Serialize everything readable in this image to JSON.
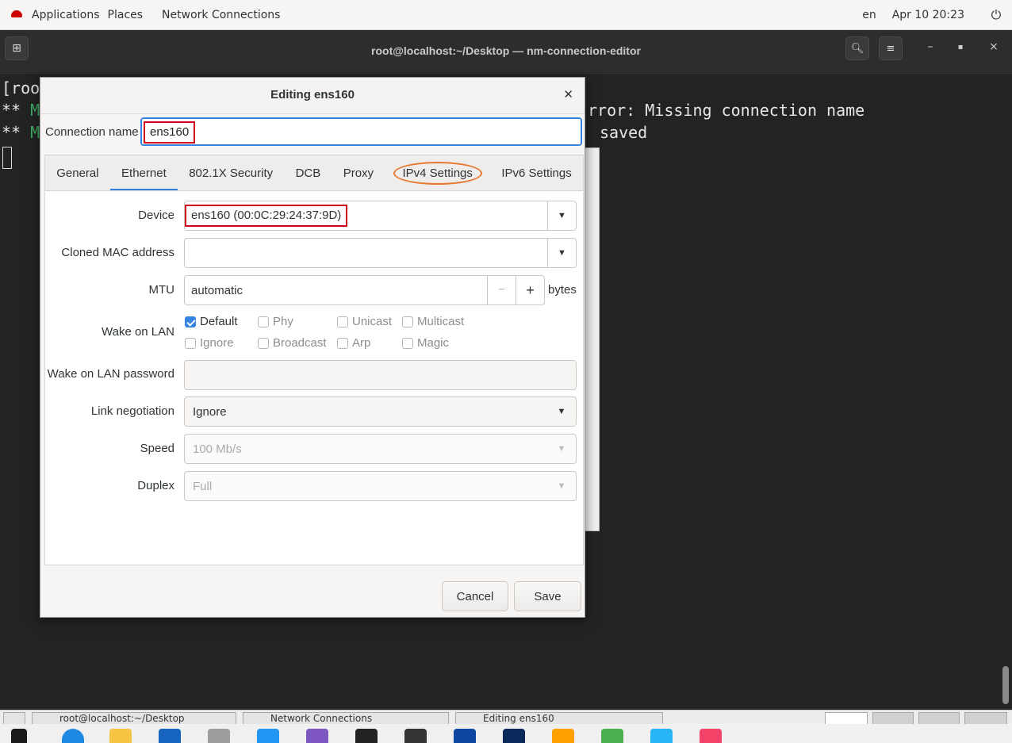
{
  "topbar": {
    "applications": "Applications",
    "places": "Places",
    "network_connections": "Network Connections",
    "lang": "en",
    "datetime": "Apr 10  20:23"
  },
  "terminal": {
    "title": "root@localhost:~/Desktop — nm-connection-editor",
    "lines": [
      "[roo",
      "** M",
      "** M"
    ],
    "right_line1": "rror: Missing connection name",
    "right_line2": "saved"
  },
  "dialog": {
    "title": "Editing ens160",
    "connection_name_label": "Connection name",
    "connection_name_value": "ens160",
    "tabs": [
      "General",
      "Ethernet",
      "802.1X Security",
      "DCB",
      "Proxy",
      "IPv4 Settings",
      "IPv6 Settings"
    ],
    "active_tab": "Ethernet",
    "device_label": "Device",
    "device_value": "ens160 (00:0C:29:24:37:9D)",
    "cloned_mac_label": "Cloned MAC address",
    "cloned_mac_value": "",
    "mtu_label": "MTU",
    "mtu_value": "automatic",
    "mtu_unit": "bytes",
    "wol_label": "Wake on LAN",
    "wol_options": {
      "default": "Default",
      "phy": "Phy",
      "unicast": "Unicast",
      "multicast": "Multicast",
      "ignore": "Ignore",
      "broadcast": "Broadcast",
      "arp": "Arp",
      "magic": "Magic"
    },
    "wol_password_label": "Wake on LAN password",
    "wol_password_value": "",
    "link_negotiation_label": "Link negotiation",
    "link_negotiation_value": "Ignore",
    "speed_label": "Speed",
    "speed_value": "100 Mb/s",
    "duplex_label": "Duplex",
    "duplex_value": "Full",
    "cancel": "Cancel",
    "save": "Save"
  },
  "taskbar": {
    "task1": "root@localhost:~/Desktop",
    "task2": "Network Connections",
    "task3": "Editing ens160"
  },
  "colors": {
    "accent": "#3584e4",
    "highlight_red": "#d0021b",
    "highlight_orange": "#e8782e"
  }
}
